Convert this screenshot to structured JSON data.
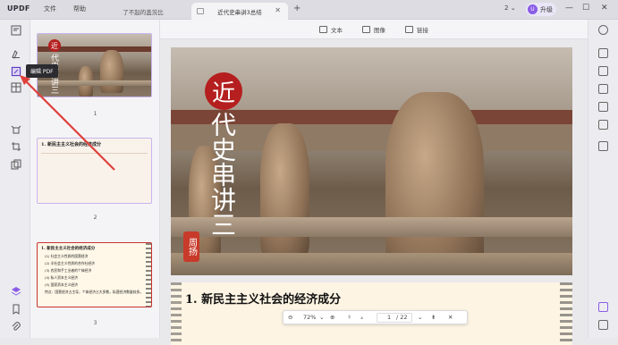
{
  "titlebar": {
    "logo_main": "UPDF",
    "menus": [
      "文件",
      "帮助"
    ],
    "tabs": [
      {
        "label": "了不起的盖茨比",
        "active": false
      },
      {
        "label": "近代史串讲3总结",
        "active": true
      }
    ],
    "page_indicator": "2",
    "upgrade_avatar": "U",
    "upgrade_label": "升级"
  },
  "tooltip": {
    "text": "编辑 PDF"
  },
  "toolbar": {
    "text_label": "文本",
    "image_label": "图像",
    "link_label": "链接"
  },
  "thumbnails": [
    {
      "page": "1"
    },
    {
      "page": "2",
      "heading": "1. 新民主主义社会的经济成分"
    },
    {
      "page": "3",
      "heading": "1. 新民主主义社会的经济成分",
      "lines": [
        "(1) 社会主义性质的国营经济",
        "(2) 半社会主义性质的合作社经济",
        "(3) 农民和手工业者的个体经济",
        "(4) 私人资本主义经济",
        "(5) 国家资本主义经济",
        "特点：国营经济占主导，个体经济占大多数，私营经济数量较多。"
      ]
    }
  ],
  "page1": {
    "seal_char": "近",
    "title_vertical": "代史串讲三",
    "stamp": "周扬"
  },
  "page2": {
    "heading": "1. 新民主主义社会的经济成分"
  },
  "zoombar": {
    "zoom": "72%",
    "current_page": "1",
    "total": "/ 22"
  },
  "colors": {
    "accent": "#7c5cd6",
    "seal_red": "#b51f1f",
    "arrow": "#e0403c"
  }
}
